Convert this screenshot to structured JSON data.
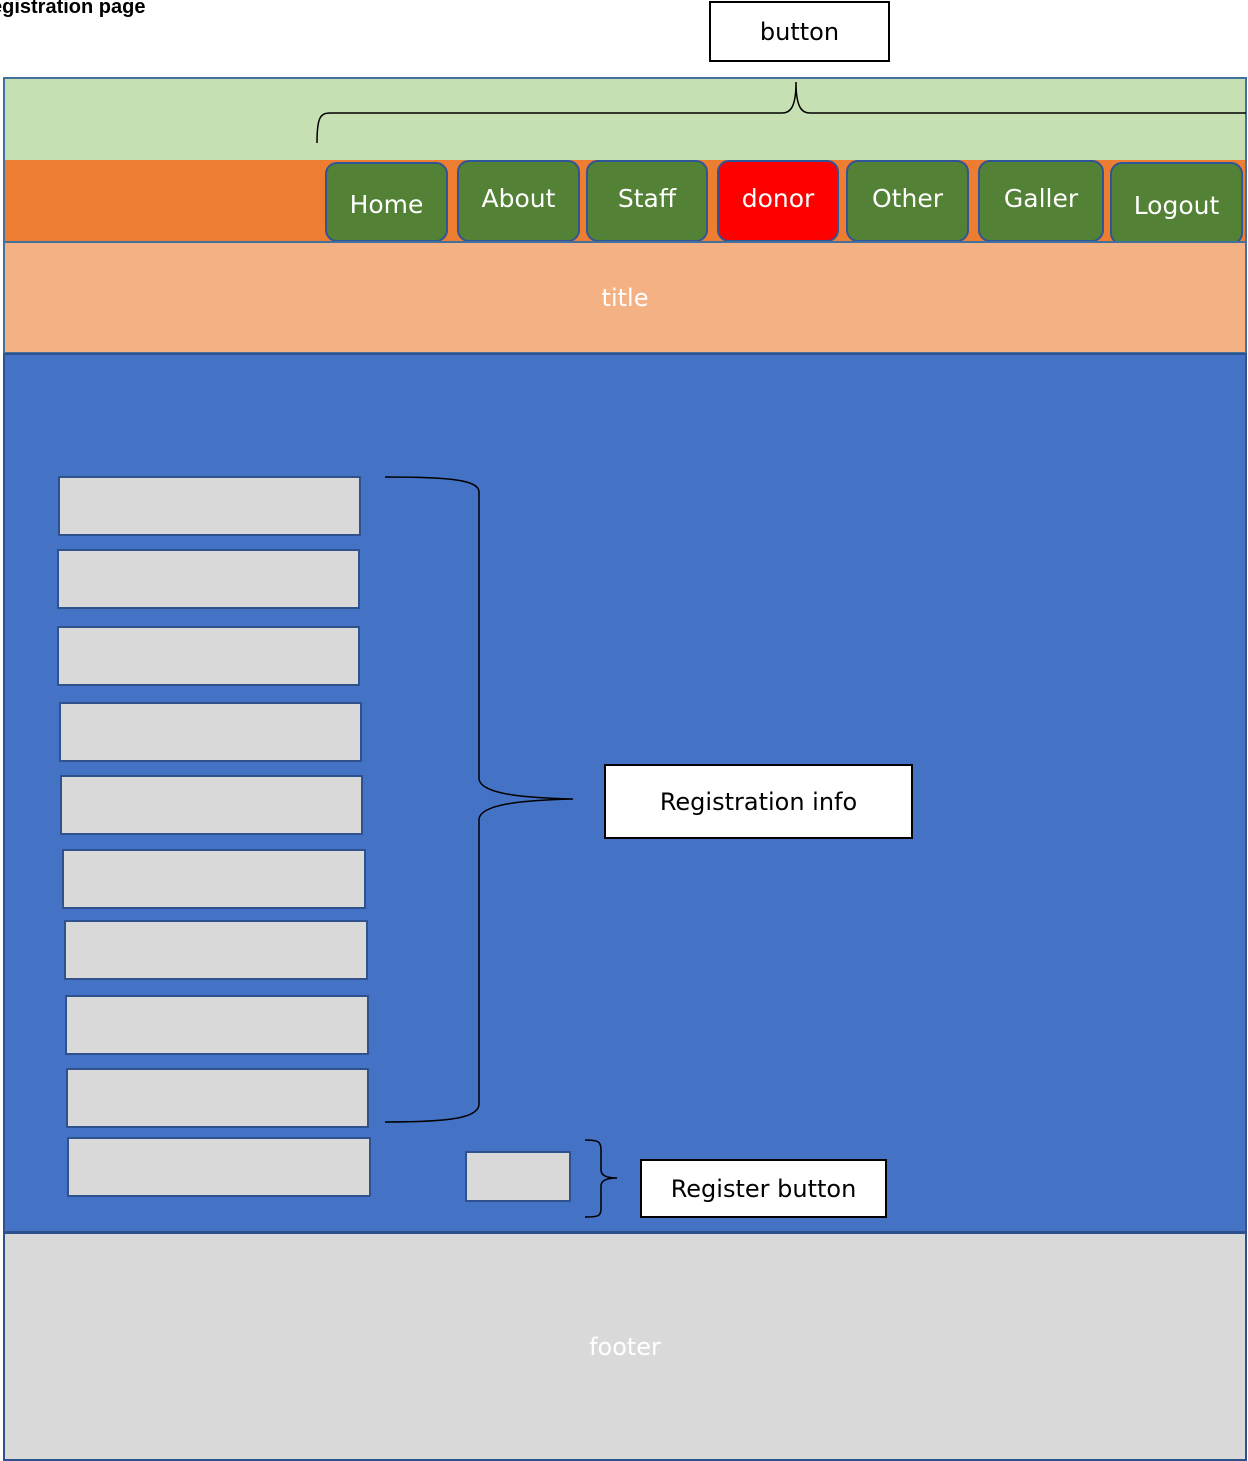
{
  "page_title": "egistration page",
  "callouts": {
    "button": "button",
    "registration_info": "Registration info",
    "register_button": "Register button"
  },
  "nav": {
    "items": [
      {
        "label": "Home",
        "active": false
      },
      {
        "label": "About",
        "active": false
      },
      {
        "label": "Staff",
        "active": false
      },
      {
        "label": "donor",
        "active": true
      },
      {
        "label": "Other",
        "active": false
      },
      {
        "label": "Galler",
        "active": false
      },
      {
        "label": "Logout",
        "active": false
      }
    ]
  },
  "title_band": {
    "label": "title"
  },
  "form": {
    "field_count": 10
  },
  "footer": {
    "label": "footer"
  },
  "colors": {
    "top_band": "#c6e0b4",
    "nav_bar": "#ed7d31",
    "nav_button": "#538135",
    "nav_active": "#ff0000",
    "title_band": "#f4b183",
    "main_area": "#4472c4",
    "field": "#d9d9d9",
    "footer": "#d9d9d9"
  }
}
